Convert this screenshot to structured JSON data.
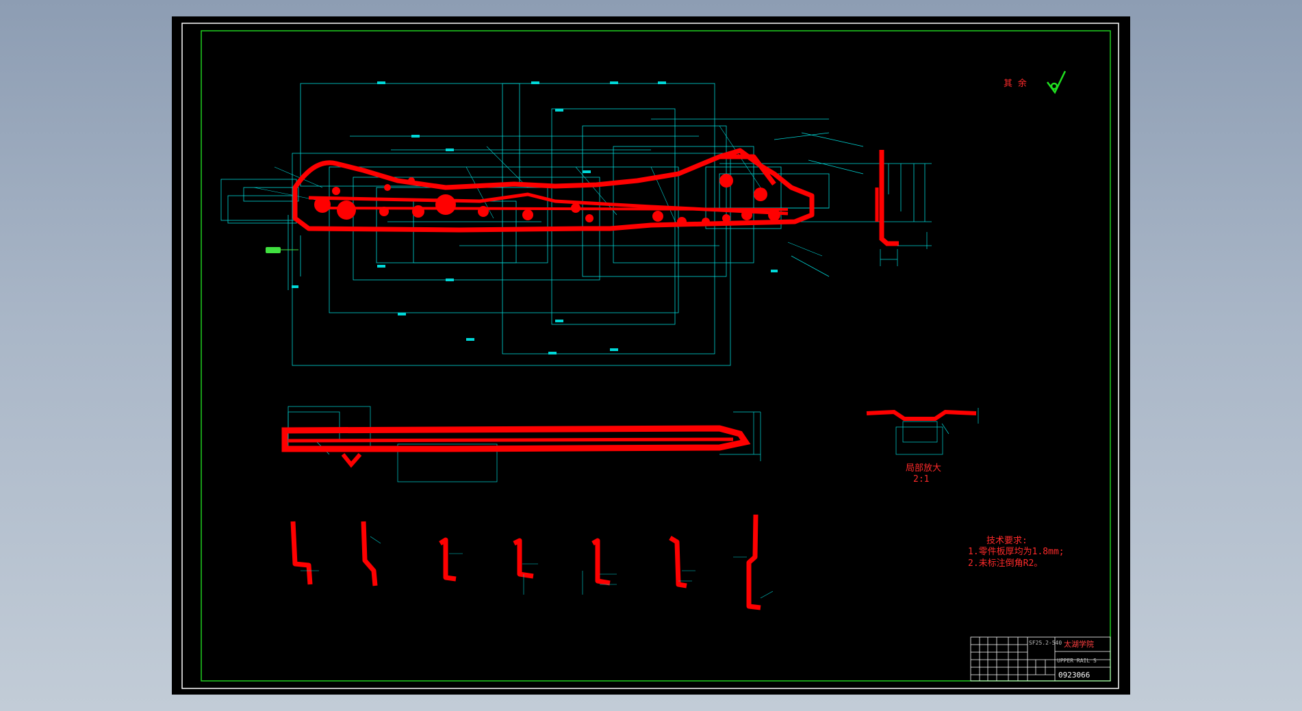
{
  "drawing": {
    "surface_mark_text": "其 余",
    "detail_title": "局部放大",
    "detail_scale": "2:1",
    "tech_req_title": "技术要求:",
    "tech_req_items": [
      "1.零件板厚均为1.8mm;",
      "2.未标注倒角R2。"
    ],
    "title_block": {
      "school": "太湖学院",
      "model": "SF25.2-540",
      "part_name": "UPPER RAIL S",
      "number": "0923066"
    }
  },
  "colors": {
    "background": "#000000",
    "frame": "#ffffff",
    "inner_frame": "#20d020",
    "dimension": "#00e5e5",
    "part": "#ff0000",
    "title_block": "#ffffff"
  }
}
